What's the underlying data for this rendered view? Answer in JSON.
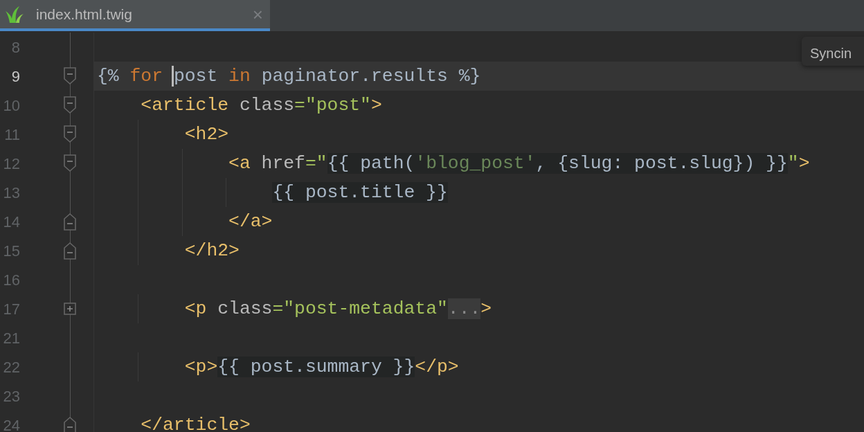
{
  "tab": {
    "label": "index.html.twig",
    "selected": true,
    "close": "×"
  },
  "tooltip": {
    "text": "Syncin"
  },
  "lines": [
    {
      "number": "8",
      "kind": "plain",
      "current": false
    },
    {
      "number": "9",
      "kind": "fold-start",
      "current": true,
      "tokens": [
        {
          "text": "{%",
          "kind": "code"
        },
        {
          "text": " for ",
          "kind": "keyword"
        },
        {
          "kind": "caret"
        },
        {
          "text": "post",
          "kind": "code"
        },
        {
          "text": " in",
          "kind": "keyword"
        },
        {
          "text": " paginator.results %}",
          "kind": "code"
        }
      ]
    },
    {
      "number": "10",
      "kind": "fold-start",
      "current": false,
      "tokens": [
        {
          "text": "    <article",
          "kind": "tag"
        },
        {
          "text": " class",
          "kind": "attr"
        },
        {
          "text": "=\"post\"",
          "kind": "string"
        },
        {
          "text": ">",
          "kind": "tag"
        }
      ]
    },
    {
      "number": "11",
      "kind": "fold-start",
      "current": false,
      "tokens": [
        {
          "text": "        <h2>",
          "kind": "tag"
        }
      ]
    },
    {
      "number": "12",
      "kind": "fold-start",
      "current": false,
      "tokens": [
        {
          "text": "            <a",
          "kind": "tag"
        },
        {
          "text": " href",
          "kind": "attr"
        },
        {
          "text": "=\"",
          "kind": "string"
        },
        {
          "text": "{{ path(",
          "kind": "twig"
        },
        {
          "text": "'blog_post'",
          "kind": "twig-string"
        },
        {
          "text": ", {slug: post.slug}) }}",
          "kind": "twig"
        },
        {
          "text": "\"",
          "kind": "string"
        },
        {
          "text": ">",
          "kind": "tag"
        }
      ]
    },
    {
      "number": "13",
      "kind": "plain",
      "current": false,
      "tokens": [
        {
          "text": "                {{ post.title }}",
          "kind": "twig"
        }
      ]
    },
    {
      "number": "14",
      "kind": "fold-end",
      "current": false,
      "tokens": [
        {
          "text": "            </a>",
          "kind": "tag"
        }
      ]
    },
    {
      "number": "15",
      "kind": "fold-end",
      "current": false,
      "tokens": [
        {
          "text": "        </h2>",
          "kind": "tag"
        }
      ]
    },
    {
      "number": "16",
      "kind": "plain",
      "current": false
    },
    {
      "number": "17",
      "kind": "collapsed",
      "current": false,
      "tokens": [
        {
          "text": "        <p",
          "kind": "tag"
        },
        {
          "text": " class",
          "kind": "attr"
        },
        {
          "text": "=\"post-metadata\"",
          "kind": "string"
        },
        {
          "text": "...",
          "kind": "folded"
        },
        {
          "text": ">",
          "kind": "tag"
        }
      ]
    },
    {
      "number": "21",
      "kind": "plain",
      "current": false
    },
    {
      "number": "22",
      "kind": "plain",
      "current": false,
      "tokens": [
        {
          "text": "        <p>",
          "kind": "tag"
        },
        {
          "text": "{{ post.summary }}",
          "kind": "twig"
        },
        {
          "text": "</p>",
          "kind": "tag"
        }
      ]
    },
    {
      "number": "23",
      "kind": "plain",
      "current": false
    },
    {
      "number": "24",
      "kind": "fold-end",
      "current": false,
      "tokens": [
        {
          "text": "    </article>",
          "kind": "tag"
        }
      ]
    }
  ]
}
